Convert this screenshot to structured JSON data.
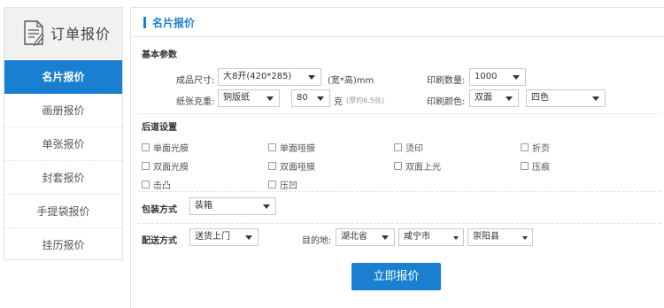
{
  "sidebar": {
    "title": "订单报价",
    "items": [
      {
        "label": "名片报价",
        "active": true
      },
      {
        "label": "画册报价",
        "active": false
      },
      {
        "label": "单张报价",
        "active": false
      },
      {
        "label": "封套报价",
        "active": false
      },
      {
        "label": "手提袋报价",
        "active": false
      },
      {
        "label": "挂历报价",
        "active": false
      }
    ]
  },
  "main": {
    "title": "名片报价",
    "basic": {
      "section_title": "基本参数",
      "size_label": "成品尺寸:",
      "size_value": "大8开(420*285)",
      "size_unit": "(宽*高)mm",
      "qty_label": "印刷数量:",
      "qty_value": "1000",
      "paper_label": "纸张克重:",
      "paper_value": "铜版纸",
      "weight_value": "80",
      "weight_unit": "克",
      "weight_hint": "(厚约6.5丝)",
      "color_label": "印刷颜色:",
      "side_value": "双面",
      "color_value": "四色"
    },
    "post": {
      "section_title": "后道设置",
      "options": [
        "单面光膜",
        "单面哑膜",
        "烫印",
        "折页",
        "双面光膜",
        "双面哑膜",
        "双面上光",
        "压痕",
        "击凸",
        "压凹"
      ]
    },
    "packing": {
      "label": "包装方式",
      "value": "装箱"
    },
    "delivery": {
      "label": "配送方式",
      "method_value": "送货上门",
      "dest_label": "目的地:",
      "province": "湖北省",
      "city": "咸宁市",
      "county": "崇阳县"
    },
    "submit_label": "立即报价"
  },
  "colors": {
    "accent": "#1a7fd0"
  }
}
